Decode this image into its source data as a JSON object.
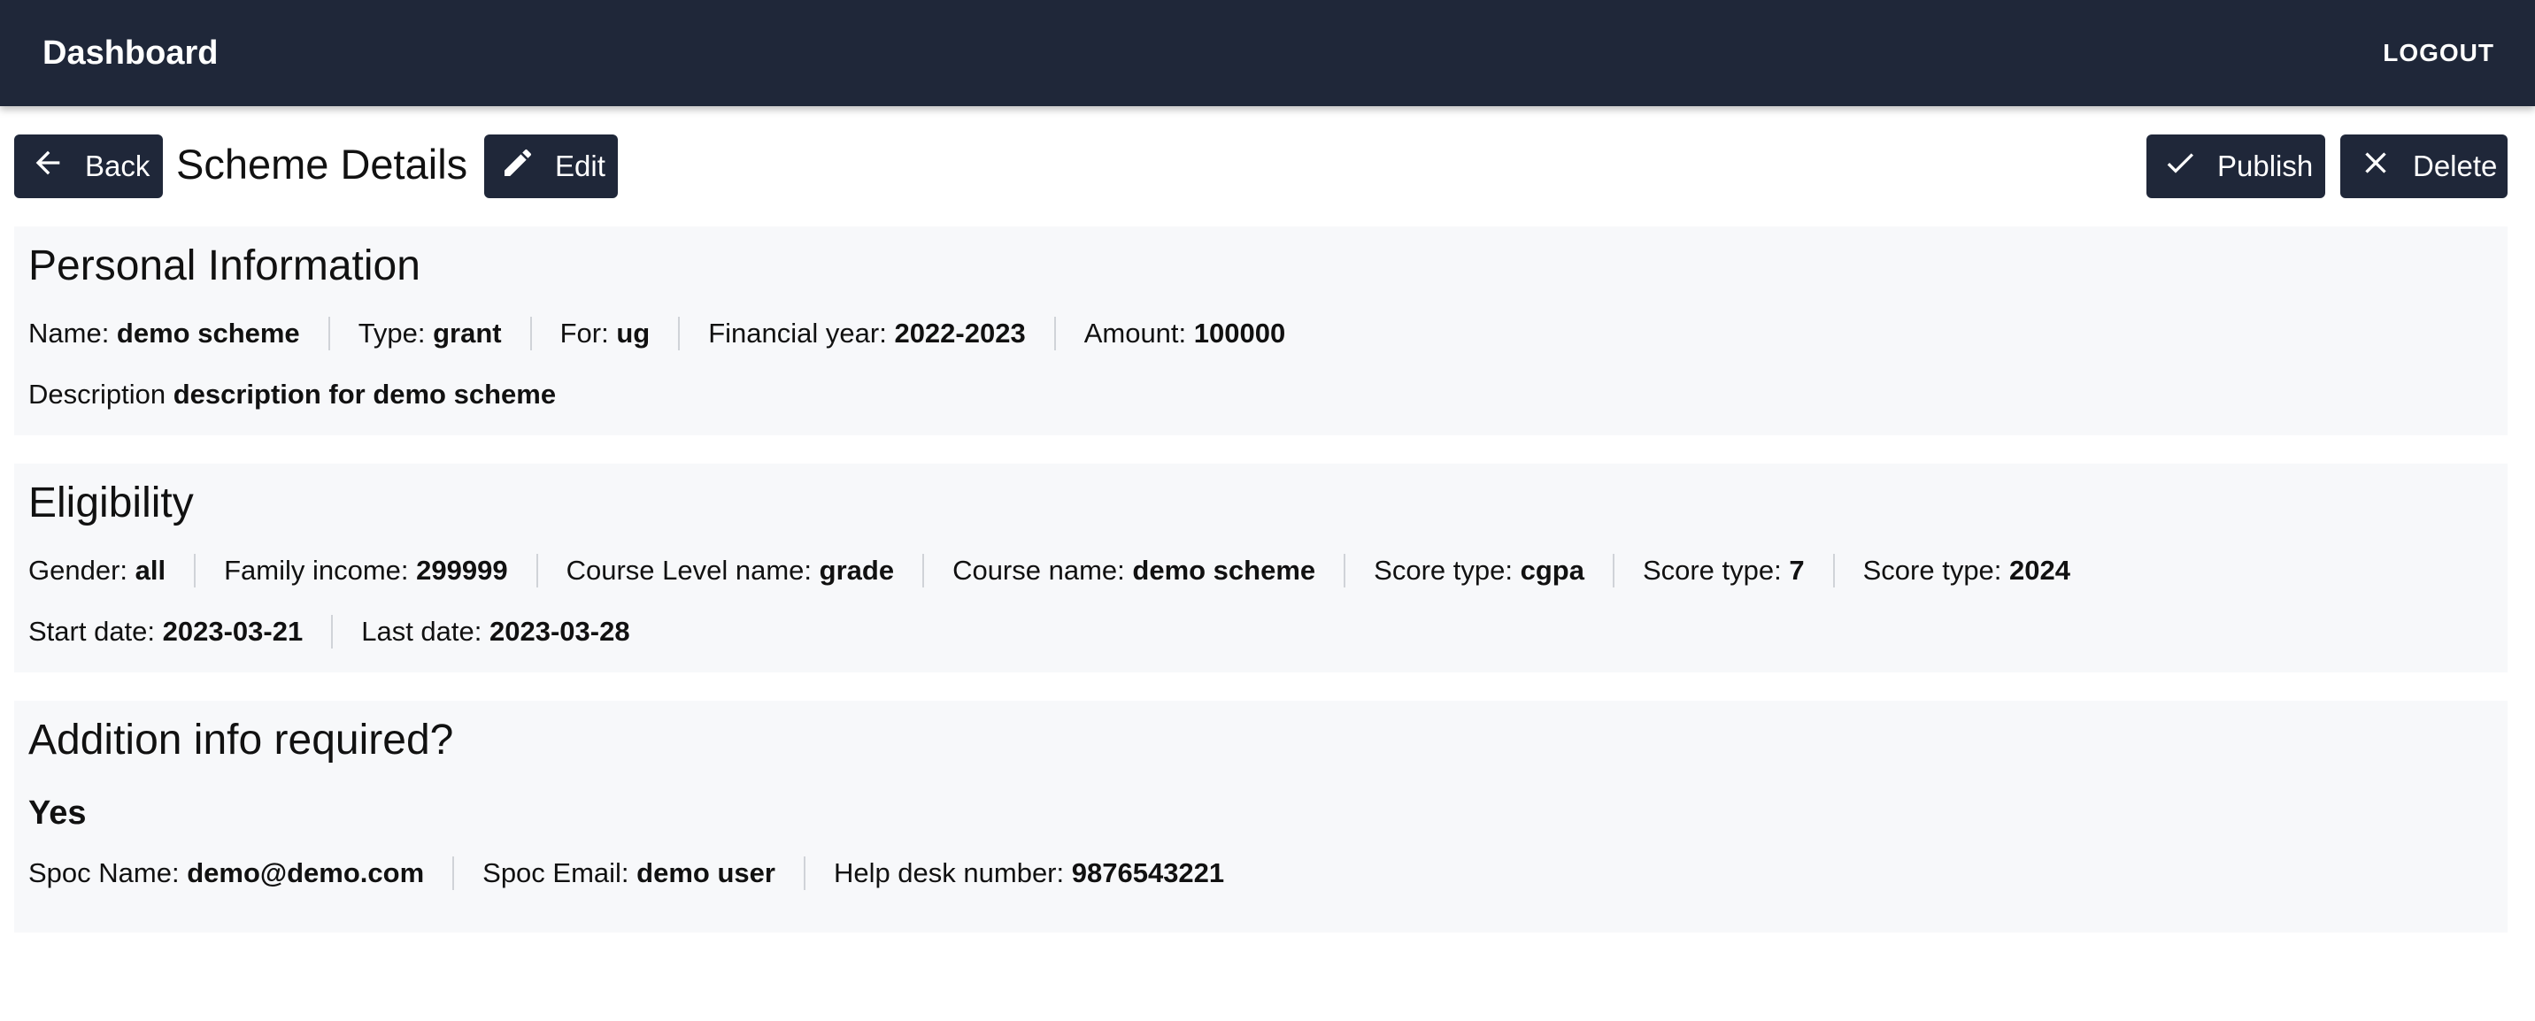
{
  "appbar": {
    "title": "Dashboard",
    "logout": "LOGOUT"
  },
  "toolbar": {
    "back_label": "Back",
    "page_title": "Scheme Details",
    "edit_label": "Edit",
    "publish_label": "Publish",
    "delete_label": "Delete"
  },
  "personal": {
    "heading": "Personal Information",
    "name_label": "Name: ",
    "name_value": "demo scheme",
    "type_label": "Type: ",
    "type_value": "grant",
    "for_label": "For: ",
    "for_value": "ug",
    "fy_label": "Financial year: ",
    "fy_value": "2022-2023",
    "amount_label": "Amount: ",
    "amount_value": "100000",
    "desc_label": "Description ",
    "desc_value": "description for demo scheme"
  },
  "eligibility": {
    "heading": "Eligibility",
    "gender_label": "Gender: ",
    "gender_value": "all",
    "income_label": "Family income: ",
    "income_value": "299999",
    "course_level_label": "Course Level name: ",
    "course_level_value": "grade",
    "course_name_label": "Course name: ",
    "course_name_value": "demo scheme",
    "score1_label": "Score type: ",
    "score1_value": "cgpa",
    "score2_label": "Score type: ",
    "score2_value": "7",
    "score3_label": "Score type: ",
    "score3_value": "2024",
    "start_label": "Start date: ",
    "start_value": "2023-03-21",
    "last_label": "Last date: ",
    "last_value": "2023-03-28"
  },
  "additional": {
    "heading": "Addition info required?",
    "answer": "Yes",
    "spoc_name_label": "Spoc Name: ",
    "spoc_name_value": "demo@demo.com",
    "spoc_email_label": "Spoc Email: ",
    "spoc_email_value": "demo user",
    "helpdesk_label": "Help desk number: ",
    "helpdesk_value": "9876543221"
  },
  "icons": {
    "back": "arrow-left-icon",
    "edit": "pencil-icon",
    "publish": "check-icon",
    "delete": "close-icon"
  }
}
